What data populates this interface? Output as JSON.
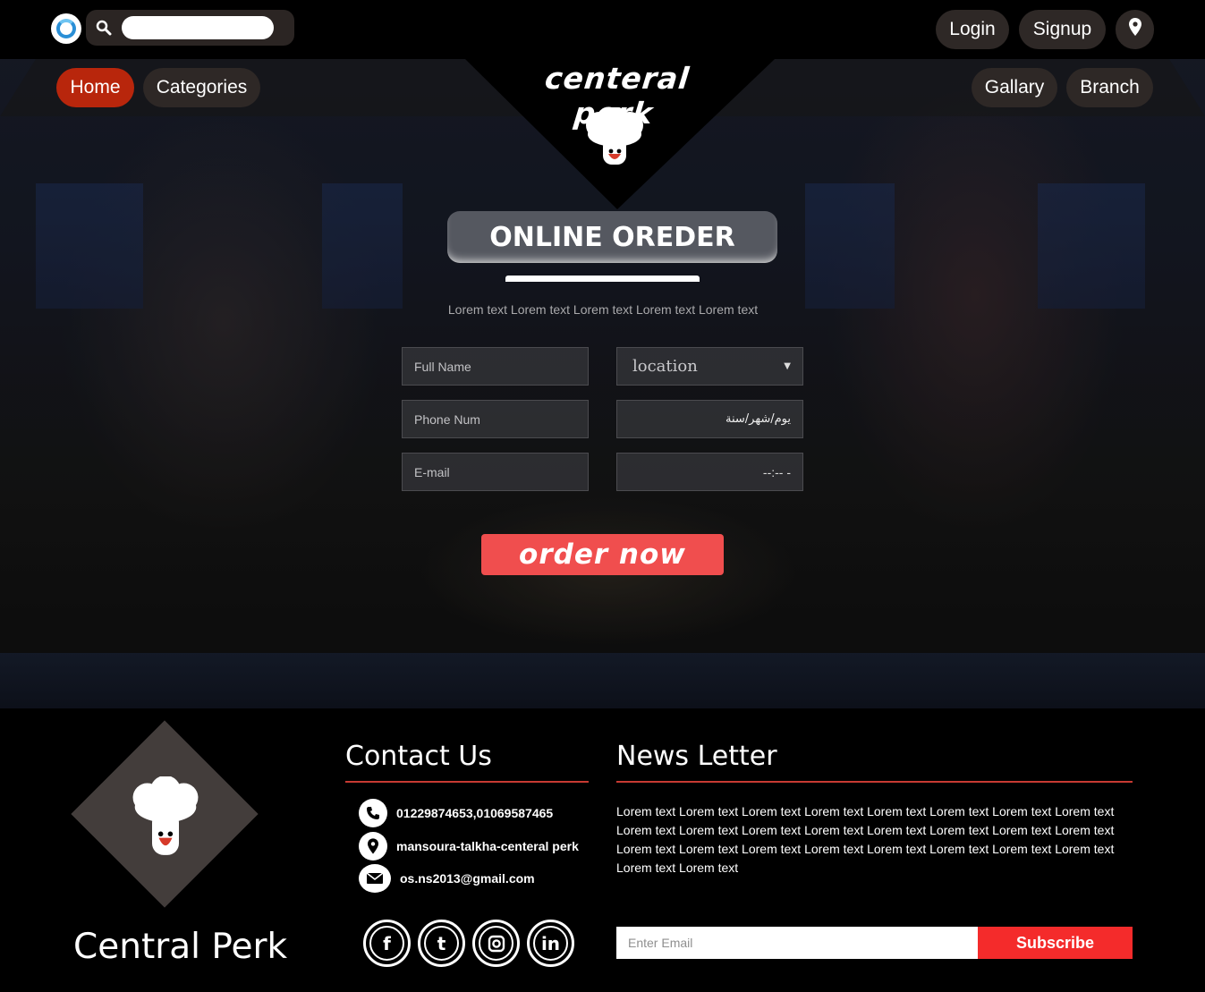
{
  "header": {
    "search": {
      "placeholder": "",
      "value": ""
    },
    "auth": {
      "login": "Login",
      "signup": "Signup"
    },
    "location_icon": "map-pin-icon"
  },
  "nav": {
    "left": [
      {
        "label": "Home",
        "active": true
      },
      {
        "label": "Categories",
        "active": false
      }
    ],
    "right": [
      {
        "label": "Gallary"
      },
      {
        "label": "Branch"
      }
    ],
    "brand": "centeral perk",
    "brand_icon": "chef-hat-icon"
  },
  "order": {
    "title": "ONLINE OREDER",
    "subtitle": "Lorem text Lorem text Lorem text Lorem text Lorem text",
    "fields": {
      "full_name_placeholder": "Full Name",
      "phone_placeholder": "Phone Num",
      "email_placeholder": "E-mail",
      "location": "location",
      "date": "يوم/شهر/سنة",
      "time": "--:-- -"
    },
    "button": "order now"
  },
  "footer": {
    "brand": "Central Perk",
    "contact": {
      "title": "Contact Us",
      "phone": "01229874653,01069587465",
      "address": "mansoura-talkha-centeral perk",
      "email": "os.ns2013@gmail.com"
    },
    "social": [
      "facebook-icon",
      "twitter-icon",
      "instagram-icon",
      "linkedin-icon"
    ],
    "newsletter": {
      "title": "News Letter",
      "text": "Lorem text Lorem text Lorem text Lorem text Lorem text Lorem text Lorem text Lorem text Lorem text Lorem text Lorem text Lorem text Lorem text Lorem text Lorem text Lorem text Lorem text Lorem text Lorem text Lorem text Lorem text Lorem text Lorem text Lorem text Lorem text Lorem text",
      "email_placeholder": "Enter Email",
      "subscribe": "Subscribe"
    }
  },
  "colors": {
    "accent_red": "#f04e4e",
    "active_nav": "#b8260c",
    "pill_bg": "#2e2826",
    "rule_red": "#c73a32"
  }
}
